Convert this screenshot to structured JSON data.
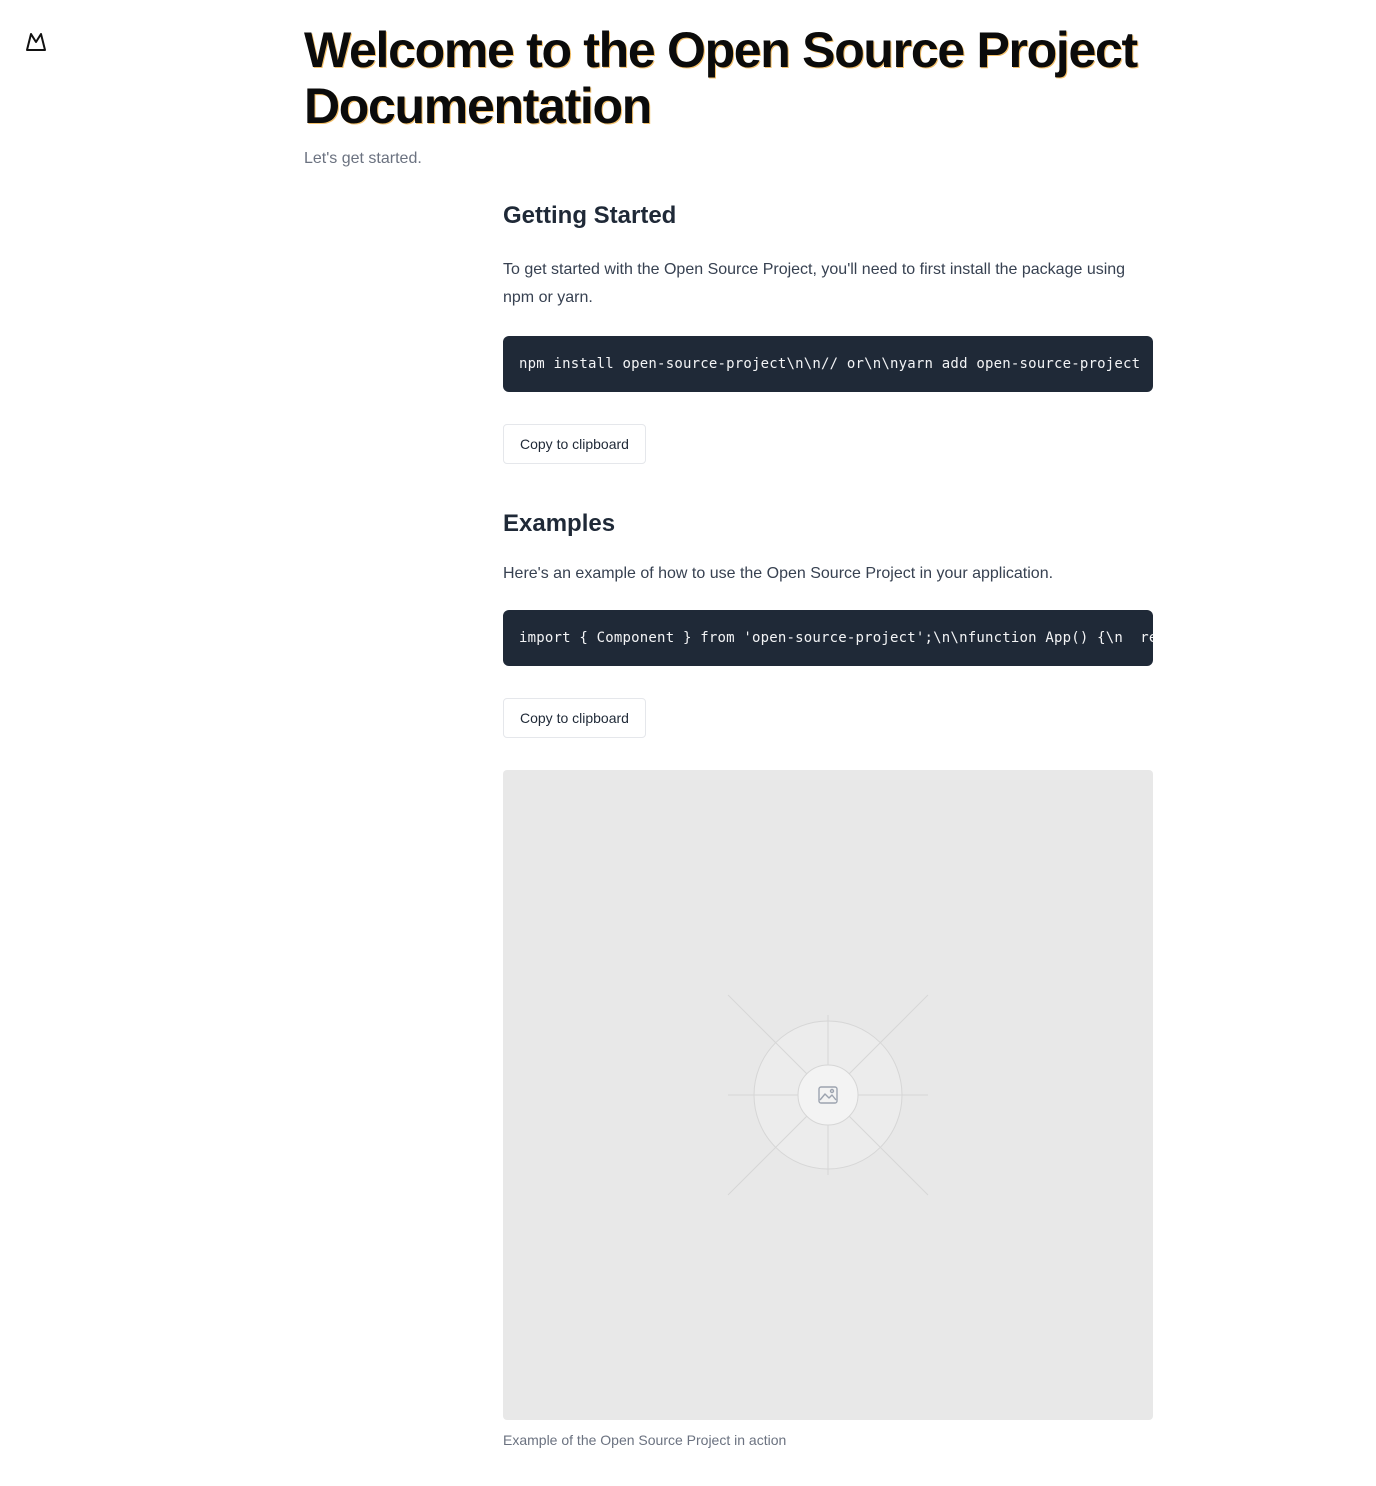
{
  "logo": {
    "icon": "mountain-logo-icon"
  },
  "hero": {
    "title": "Welcome to the Open Source Project Documentation",
    "subtitle": "Let's get started."
  },
  "sections": [
    {
      "title": "Getting Started",
      "text": "To get started with the Open Source Project, you'll need to first install the package using npm or yarn.",
      "code": "npm install open-source-project\\n\\n// or\\n\\nyarn add open-source-project",
      "copy_label": "Copy to clipboard"
    },
    {
      "title": "Examples",
      "text": "Here's an example of how to use the Open Source Project in your application.",
      "code": "import { Component } from 'open-source-project';\\n\\nfunction App() {\\n  return <Component />;\\n}",
      "copy_label": "Copy to clipboard"
    }
  ],
  "figure": {
    "icon": "image-placeholder-icon",
    "caption": "Example of the Open Source Project in action"
  },
  "colors": {
    "code_background": "#1f2937",
    "placeholder_background": "#e8e8e8",
    "muted_text": "#6b7280"
  }
}
